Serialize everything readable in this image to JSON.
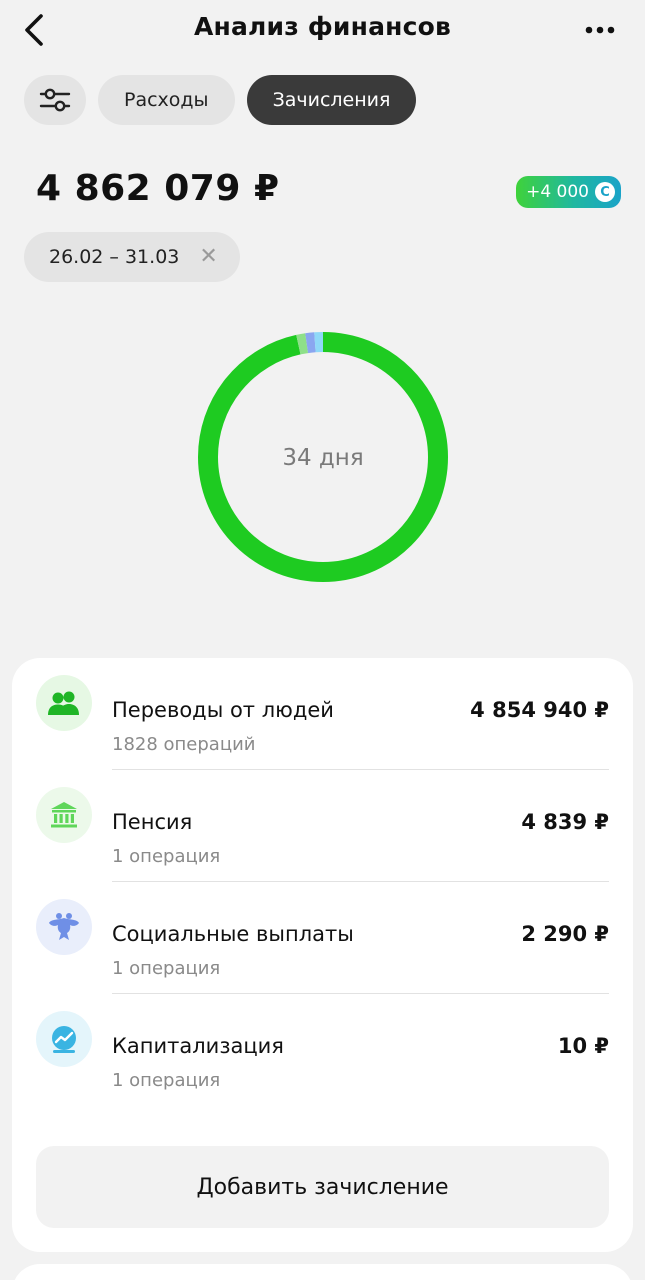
{
  "header": {
    "title": "Анализ финансов",
    "back_icon": "chevron-left-icon",
    "more_icon": "more-horizontal-icon"
  },
  "filters": {
    "settings_icon": "sliders-icon",
    "tabs": [
      {
        "label": "Расходы",
        "active": false
      },
      {
        "label": "Зачисления",
        "active": true
      }
    ]
  },
  "summary": {
    "total": "4 862 079 ₽",
    "bonus": "+4 000",
    "bonus_coin": "С",
    "period": "26.02 – 31.03",
    "clear_symbol": "✕"
  },
  "chart_data": {
    "type": "pie",
    "center_label": "34 дня",
    "slices": [
      {
        "label": "Переводы от людей",
        "value": 4854940,
        "color": "#1ecb21"
      },
      {
        "label": "Пенсия",
        "value": 4839,
        "color": "#8ee089"
      },
      {
        "label": "Социальные выплаты",
        "value": 2290,
        "color": "#8aa6f0"
      },
      {
        "label": "Капитализация",
        "value": 10,
        "color": "#8fd8f8"
      }
    ]
  },
  "categories": [
    {
      "name": "Переводы от людей",
      "count": "1828 операций",
      "amount": "4 854 940 ₽",
      "icon": "people-icon",
      "icon_bg": "#e6f8e4",
      "icon_color": "#1fb526"
    },
    {
      "name": "Пенсия",
      "count": "1 операция",
      "amount": "4 839 ₽",
      "icon": "bank-icon",
      "icon_bg": "#ecf9ea",
      "icon_color": "#5fd65a"
    },
    {
      "name": "Социальные выплаты",
      "count": "1 операция",
      "amount": "2 290 ₽",
      "icon": "eagle-emblem-icon",
      "icon_bg": "#e9eefb",
      "icon_color": "#6f8fe6"
    },
    {
      "name": "Капитализация",
      "count": "1 операция",
      "amount": "10 ₽",
      "icon": "growth-chart-icon",
      "icon_bg": "#e4f5fb",
      "icon_color": "#3ab4e2"
    }
  ],
  "actions": {
    "add_label": "Добавить зачисление"
  }
}
